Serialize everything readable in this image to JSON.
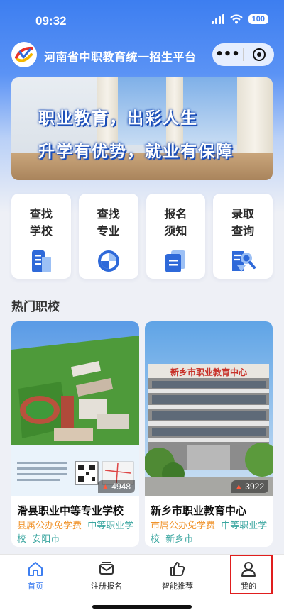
{
  "status_bar": {
    "time": "09:32",
    "battery": "100"
  },
  "nav": {
    "title": "河南省中职教育统一招生平台",
    "more_label": "•••"
  },
  "banner": {
    "line1": "职业教育，出彩人生",
    "line2": "升学有优势，就业有保障"
  },
  "quick_menu": [
    {
      "line1": "查找",
      "line2": "学校",
      "icon": "building-icon"
    },
    {
      "line1": "查找",
      "line2": "专业",
      "icon": "pie-chart-icon"
    },
    {
      "line1": "报名",
      "line2": "须知",
      "icon": "document-icon"
    },
    {
      "line1": "录取",
      "line2": "查询",
      "icon": "search-doc-icon"
    }
  ],
  "section_title": "热门职校",
  "schools": [
    {
      "name": "滑县职业中等专业学校",
      "tag1": "县属公办免学费",
      "tag2": "中等职业学",
      "tag3": "校",
      "city": "安阳市",
      "hot": "4948"
    },
    {
      "name": "新乡市职业教育中心",
      "tag1": "市属公办免学费",
      "tag2": "中等职业学",
      "tag3": "校",
      "city": "新乡市",
      "hot": "3922",
      "photo_sign": "新乡市职业教育中心"
    }
  ],
  "tabs": [
    {
      "label": "首页",
      "icon": "home-icon",
      "active": true
    },
    {
      "label": "注册报名",
      "icon": "mail-icon",
      "active": false
    },
    {
      "label": "智能推荐",
      "icon": "thumbs-up-icon",
      "active": false
    },
    {
      "label": "我的",
      "icon": "user-icon",
      "active": false
    }
  ],
  "colors": {
    "primary": "#3d7ef0",
    "orange_tag": "#f0932b",
    "teal_tag": "#3aa6a0",
    "highlight": "#e01e1e"
  }
}
